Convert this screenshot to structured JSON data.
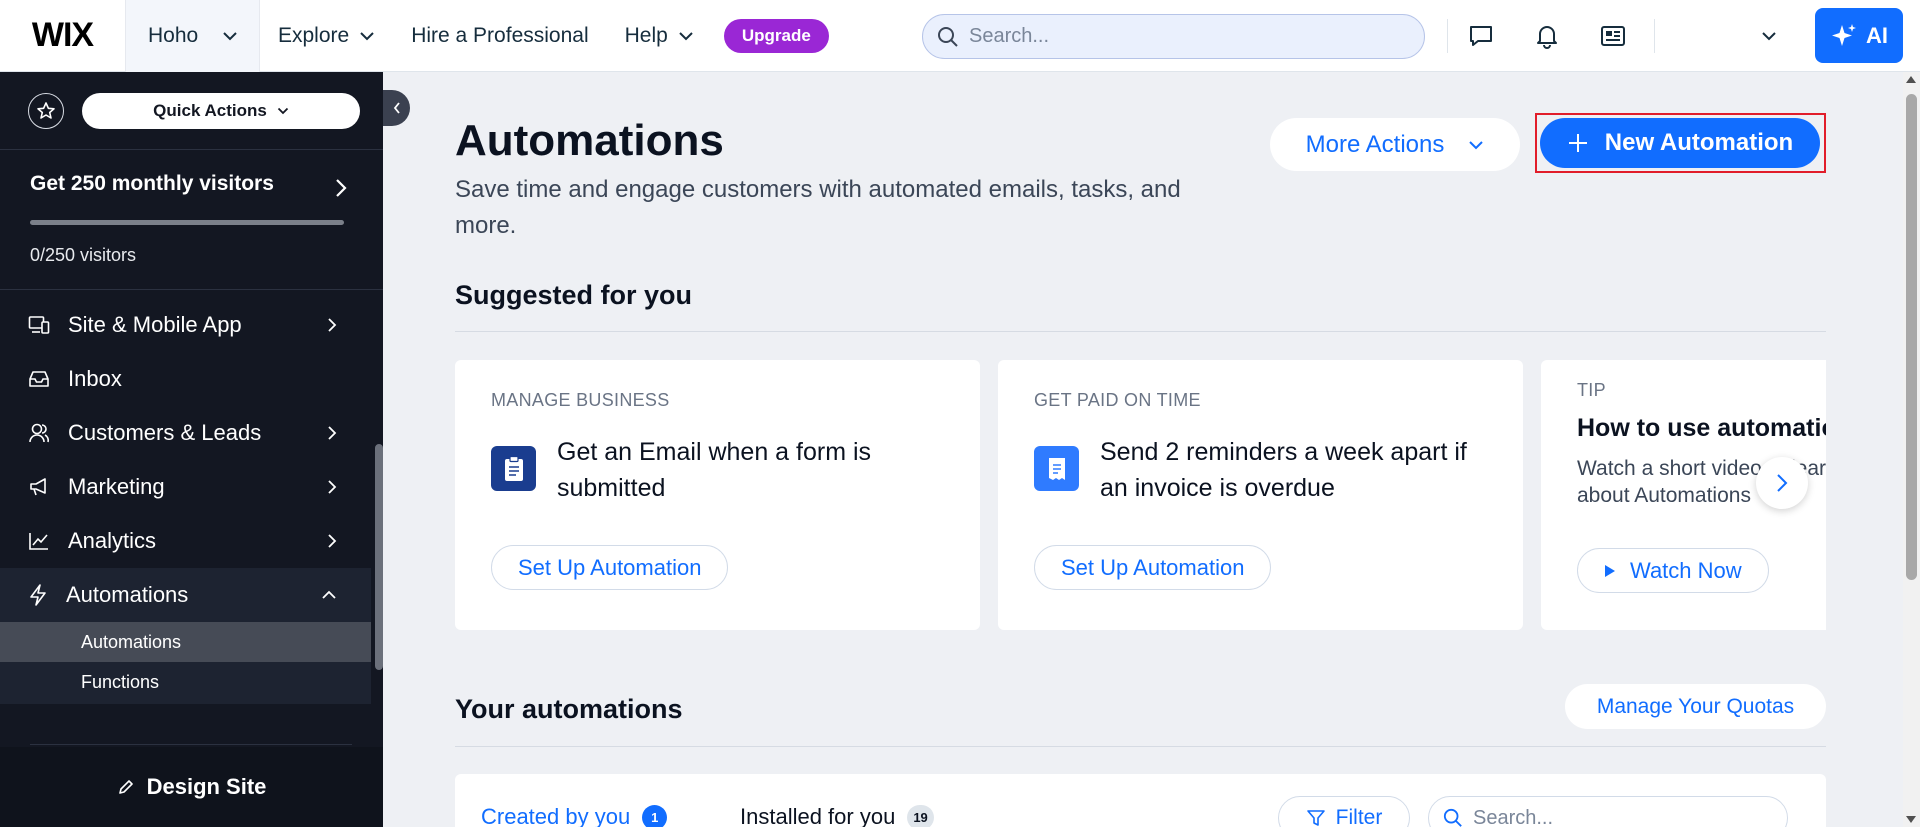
{
  "topbar": {
    "logo": "WIX",
    "site_name": "Hoho",
    "nav": [
      {
        "label": "Explore",
        "has_dropdown": true
      },
      {
        "label": "Hire a Professional",
        "has_dropdown": false
      },
      {
        "label": "Help",
        "has_dropdown": true
      }
    ],
    "upgrade_label": "Upgrade",
    "search_placeholder": "Search...",
    "icons": [
      "chat-icon",
      "bell-icon",
      "news-icon"
    ],
    "ai_label": "AI"
  },
  "sidebar": {
    "quick_actions_label": "Quick Actions",
    "visitors": {
      "title": "Get 250 monthly visitors",
      "count_label": "0/250 visitors",
      "progress": 0
    },
    "menu": [
      {
        "label": "Site & Mobile App",
        "icon": "devices-icon",
        "chevron": "right"
      },
      {
        "label": "Inbox",
        "icon": "inbox-icon",
        "chevron": ""
      },
      {
        "label": "Customers & Leads",
        "icon": "customers-icon",
        "chevron": "right"
      },
      {
        "label": "Marketing",
        "icon": "megaphone-icon",
        "chevron": "right"
      },
      {
        "label": "Analytics",
        "icon": "analytics-icon",
        "chevron": "right"
      },
      {
        "label": "Automations",
        "icon": "lightning-icon",
        "chevron": "up"
      }
    ],
    "submenu": [
      {
        "label": "Automations",
        "selected": true
      },
      {
        "label": "Functions",
        "selected": false
      }
    ],
    "design_site_label": "Design Site"
  },
  "main": {
    "title": "Automations",
    "subtitle": "Save time and engage customers with automated emails, tasks, and more.",
    "more_actions_label": "More Actions",
    "new_automation_label": "New Automation",
    "suggested_title": "Suggested for you",
    "cards": [
      {
        "kicker": "MANAGE BUSINESS",
        "text": "Get an Email when a form is submitted",
        "button": "Set Up Automation",
        "icon": "clipboard-icon",
        "icon_bg": "#1a3d8f"
      },
      {
        "kicker": "GET PAID ON TIME",
        "text": "Send 2 reminders a week apart if an invoice is overdue",
        "button": "Set Up Automation",
        "icon": "invoice-icon",
        "icon_bg": "#2f7bff"
      }
    ],
    "tip": {
      "kicker": "TIP",
      "title": "How to use automations",
      "text": "Watch a short video to learn about Automations",
      "button": "Watch Now"
    },
    "your_automations_title": "Your automations",
    "manage_quotas_label": "Manage Your Quotas",
    "tabs": [
      {
        "label": "Created by you",
        "count": "1",
        "active": true
      },
      {
        "label": "Installed for you",
        "count": "19",
        "active": false
      }
    ],
    "filter_label": "Filter",
    "list_search_placeholder": "Search..."
  },
  "colors": {
    "accent": "#116dff",
    "upgrade": "#9a27d5",
    "sidebar_bg": "#131722",
    "highlight_border": "#e11d2a"
  }
}
